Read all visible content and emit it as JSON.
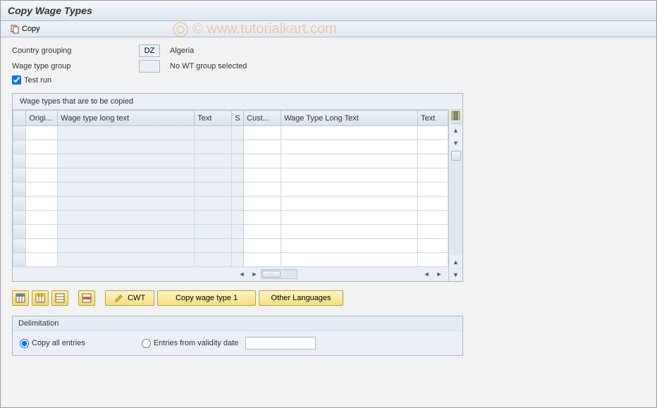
{
  "title": "Copy Wage Types",
  "toolbar": {
    "copy_label": "Copy"
  },
  "form": {
    "country_grouping_label": "Country grouping",
    "country_grouping_value": "DZ",
    "country_grouping_text": "Algeria",
    "wage_type_group_label": "Wage type group",
    "wage_type_group_value": "",
    "wage_type_group_text": "No WT group selected",
    "test_run_label": "Test run",
    "test_run_checked": true
  },
  "table": {
    "panel_title": "Wage types that are to be copied",
    "columns": {
      "origi": "Origi...",
      "wtlt": "Wage type long text",
      "text": "Text",
      "s": "S",
      "cust": "Cust...",
      "wtlt2": "Wage Type Long Text",
      "text2": "Text"
    },
    "rows": [
      {
        "origi": "",
        "wtlt": "",
        "text": "",
        "s": "",
        "cust": "",
        "wtlt2": "",
        "text2": ""
      },
      {
        "origi": "",
        "wtlt": "",
        "text": "",
        "s": "",
        "cust": "",
        "wtlt2": "",
        "text2": ""
      },
      {
        "origi": "",
        "wtlt": "",
        "text": "",
        "s": "",
        "cust": "",
        "wtlt2": "",
        "text2": ""
      },
      {
        "origi": "",
        "wtlt": "",
        "text": "",
        "s": "",
        "cust": "",
        "wtlt2": "",
        "text2": ""
      },
      {
        "origi": "",
        "wtlt": "",
        "text": "",
        "s": "",
        "cust": "",
        "wtlt2": "",
        "text2": ""
      },
      {
        "origi": "",
        "wtlt": "",
        "text": "",
        "s": "",
        "cust": "",
        "wtlt2": "",
        "text2": ""
      },
      {
        "origi": "",
        "wtlt": "",
        "text": "",
        "s": "",
        "cust": "",
        "wtlt2": "",
        "text2": ""
      },
      {
        "origi": "",
        "wtlt": "",
        "text": "",
        "s": "",
        "cust": "",
        "wtlt2": "",
        "text2": ""
      },
      {
        "origi": "",
        "wtlt": "",
        "text": "",
        "s": "",
        "cust": "",
        "wtlt2": "",
        "text2": ""
      },
      {
        "origi": "",
        "wtlt": "",
        "text": "",
        "s": "",
        "cust": "",
        "wtlt2": "",
        "text2": ""
      }
    ]
  },
  "buttons": {
    "cwt": "CWT",
    "copy_wage_type_1": "Copy wage type 1",
    "other_languages": "Other Languages"
  },
  "delimitation": {
    "title": "Delimitation",
    "copy_all_label": "Copy all entries",
    "entries_from_label": "Entries from validity date",
    "selected": "copy_all",
    "date_value": ""
  },
  "watermark": "© www.tutorialkart.com"
}
